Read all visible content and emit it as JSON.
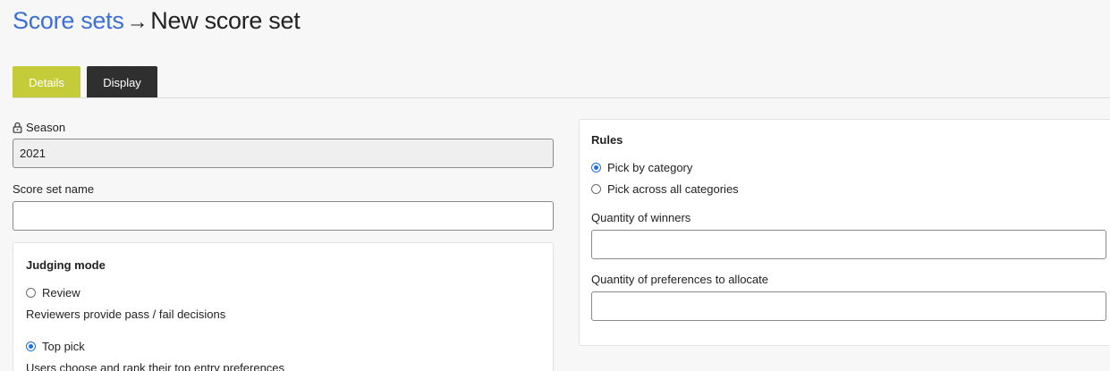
{
  "breadcrumb": {
    "parent": "Score sets",
    "separator": "→",
    "current": "New score set"
  },
  "tabs": [
    {
      "label": "Details",
      "active": true
    },
    {
      "label": "Display",
      "active": false
    }
  ],
  "form": {
    "season": {
      "label": "Season",
      "value": "2021",
      "locked": true
    },
    "score_set_name": {
      "label": "Score set name",
      "value": "",
      "placeholder": ""
    }
  },
  "judging_mode": {
    "title": "Judging mode",
    "options": [
      {
        "label": "Review",
        "description": "Reviewers provide pass / fail decisions",
        "checked": false
      },
      {
        "label": "Top pick",
        "description": "Users choose and rank their top entry preferences",
        "checked": true
      }
    ]
  },
  "rules": {
    "title": "Rules",
    "options": [
      {
        "label": "Pick by category",
        "checked": true
      },
      {
        "label": "Pick across all categories",
        "checked": false
      }
    ],
    "quantity_winners": {
      "label": "Quantity of winners",
      "value": ""
    },
    "quantity_preferences": {
      "label": "Quantity of preferences to allocate",
      "value": ""
    }
  },
  "colors": {
    "link": "#3d6fd4",
    "tab_active": "#c5cc3a",
    "tab_inactive": "#2f2f2f",
    "radio_checked": "#1f6fe5"
  }
}
